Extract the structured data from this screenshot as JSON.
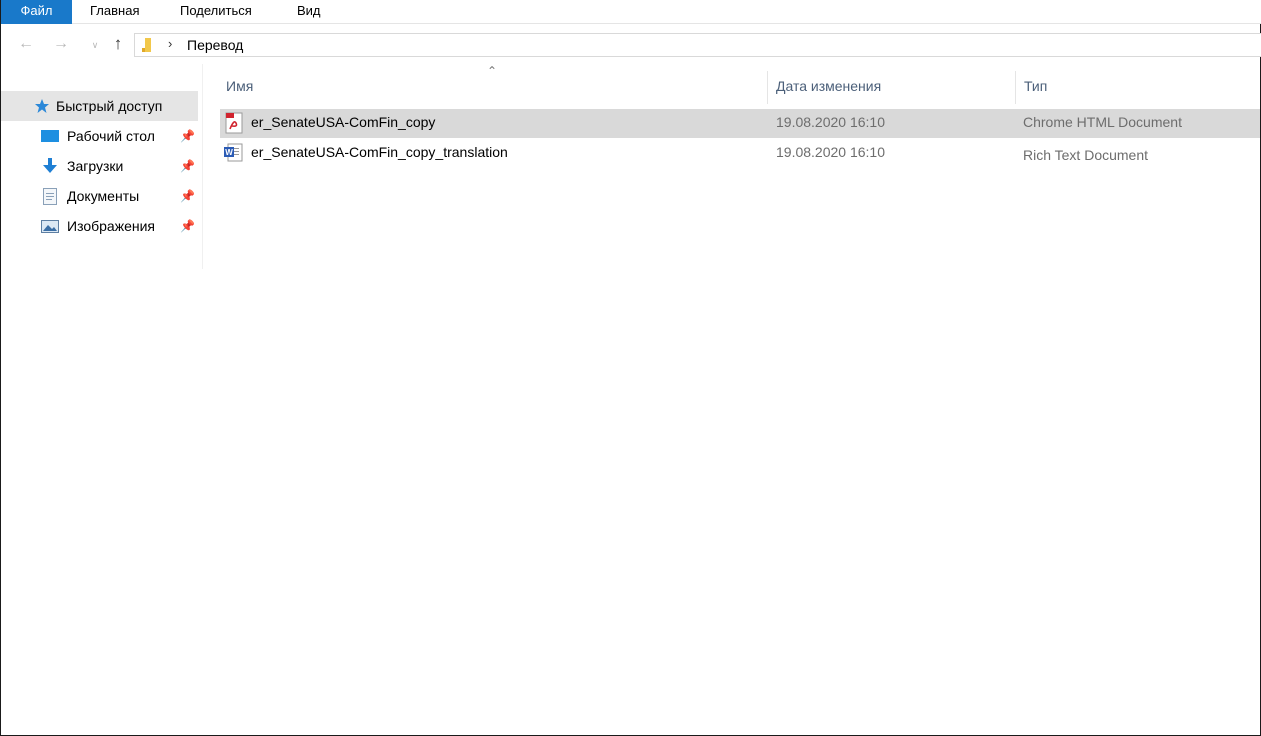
{
  "ribbon": {
    "tabs": [
      "Файл",
      "Главная",
      "Поделиться",
      "Вид"
    ]
  },
  "navigation": {
    "back_icon": "arrow-left",
    "forward_icon": "arrow-right",
    "recent_icon": "chevron-down",
    "up_icon": "arrow-up",
    "breadcrumb": [
      "Перевод"
    ]
  },
  "navpane": {
    "quick_access": "Быстрый доступ",
    "items": [
      {
        "label": "Рабочий стол",
        "icon": "desktop-icon",
        "pinned": true
      },
      {
        "label": "Загрузки",
        "icon": "download-icon",
        "pinned": true
      },
      {
        "label": "Документы",
        "icon": "documents-icon",
        "pinned": true
      },
      {
        "label": "Изображения",
        "icon": "pictures-icon",
        "pinned": true
      }
    ]
  },
  "filelist": {
    "columns": {
      "name": "Имя",
      "date": "Дата изменения",
      "type": "Тип"
    },
    "sort_icon": "chevron-up",
    "files": [
      {
        "name": "er_SenateUSA-ComFin_copy",
        "date": "19.08.2020 16:10",
        "type": "Chrome HTML Document",
        "icon": "pdf-icon",
        "selected": true
      },
      {
        "name": "er_SenateUSA-ComFin_copy_translation",
        "date": "19.08.2020 16:10",
        "type": "Rich Text Document",
        "icon": "word-icon",
        "selected": false
      }
    ]
  },
  "colors": {
    "file_tab": "#1979ca",
    "selection": "#d9d9d9",
    "header_text": "#4c607a",
    "quick_access_star": "#2b88d8"
  }
}
